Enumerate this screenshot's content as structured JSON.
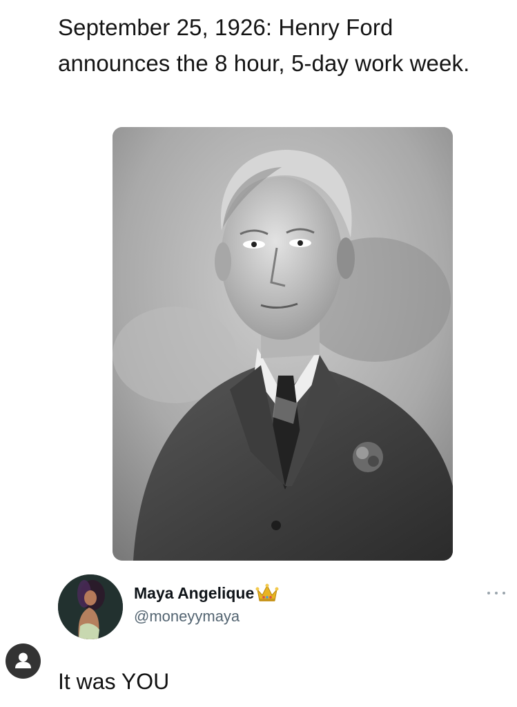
{
  "post": {
    "text": "September 25, 1926: Henry Ford announces the 8 hour, 5-day work week.",
    "image": {
      "icon": "portrait-photo"
    }
  },
  "reply": {
    "display_name": "Maya Angelique",
    "badge_emoji": "crown-icon",
    "handle": "@moneyymaya",
    "more_icon": "more-options-icon",
    "avatar_icon": "avatar"
  },
  "caption": {
    "text": "It was YOU",
    "profile_icon": "user-profile-icon"
  },
  "colors": {
    "background": "#ffffff",
    "text": "#141414",
    "handle": "#536471",
    "more_dots": "#9aa5ad",
    "profile_badge": "#333333"
  }
}
